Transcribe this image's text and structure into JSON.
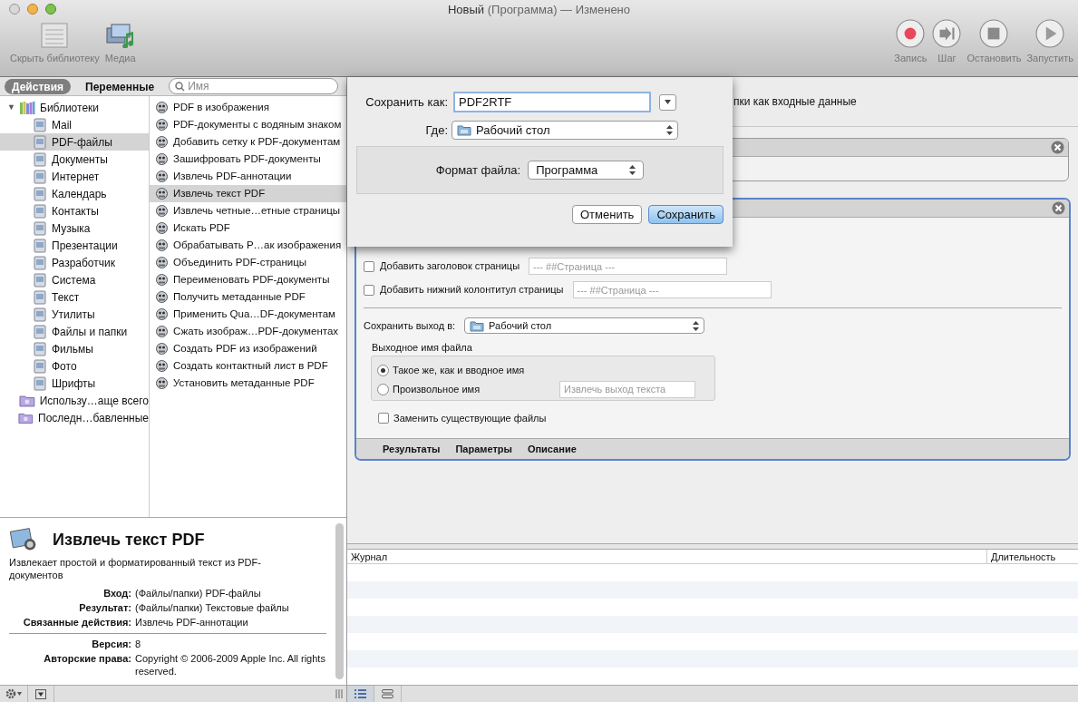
{
  "window": {
    "title_main": "Новый",
    "title_rest": "(Программа) — Изменено"
  },
  "toolbar_left": [
    {
      "label": "Скрыть библиотеку",
      "kind": "library"
    },
    {
      "label": "Медиа",
      "kind": "media"
    }
  ],
  "toolbar_right": [
    {
      "label": "Запись",
      "kind": "record"
    },
    {
      "label": "Шаг",
      "kind": "step"
    },
    {
      "label": "Остановить",
      "kind": "stop"
    },
    {
      "label": "Запустить",
      "kind": "run"
    }
  ],
  "tabs": [
    {
      "label": "Действия",
      "selected": true
    },
    {
      "label": "Переменные",
      "selected": false
    }
  ],
  "search": {
    "placeholder": "Имя"
  },
  "library": [
    {
      "label": "Библиотеки",
      "toggle": "▼",
      "expanded": true,
      "selected": false,
      "children": [
        {
          "label": "Mail",
          "selected": false
        },
        {
          "label": "PDF-файлы",
          "selected": true
        },
        {
          "label": "Документы",
          "selected": false
        },
        {
          "label": "Интернет",
          "selected": false
        },
        {
          "label": "Календарь",
          "selected": false
        },
        {
          "label": "Контакты",
          "selected": false
        },
        {
          "label": "Музыка",
          "selected": false
        },
        {
          "label": "Презентации",
          "selected": false
        },
        {
          "label": "Разработчик",
          "selected": false
        },
        {
          "label": "Система",
          "selected": false
        },
        {
          "label": "Текст",
          "selected": false
        },
        {
          "label": "Утилиты",
          "selected": false
        },
        {
          "label": "Файлы и папки",
          "selected": false
        },
        {
          "label": "Фильмы",
          "selected": false
        },
        {
          "label": "Фото",
          "selected": false
        },
        {
          "label": "Шрифты",
          "selected": false
        }
      ]
    },
    {
      "label": "Использу…аще всего",
      "selected": false
    },
    {
      "label": "Последн…бавленные",
      "selected": false
    }
  ],
  "actions": [
    {
      "label": "PDF в изображения",
      "selected": false
    },
    {
      "label": "PDF-документы с водяным знаком",
      "selected": false
    },
    {
      "label": "Добавить сетку к PDF-документам",
      "selected": false
    },
    {
      "label": "Зашифровать PDF-документы",
      "selected": false
    },
    {
      "label": "Извлечь PDF-аннотации",
      "selected": false
    },
    {
      "label": "Извлечь текст PDF",
      "selected": true
    },
    {
      "label": "Извлечь четные…етные страницы",
      "selected": false
    },
    {
      "label": "Искать PDF",
      "selected": false
    },
    {
      "label": "Обрабатывать P…ак изображения",
      "selected": false
    },
    {
      "label": "Объединить PDF-страницы",
      "selected": false
    },
    {
      "label": "Переименовать PDF-документы",
      "selected": false
    },
    {
      "label": "Получить метаданные PDF",
      "selected": false
    },
    {
      "label": "Применить Qua…DF-документам",
      "selected": false
    },
    {
      "label": "Сжать изображ…PDF-документах",
      "selected": false
    },
    {
      "label": "Создать PDF из изображений",
      "selected": false
    },
    {
      "label": "Создать контактный лист в PDF",
      "selected": false
    },
    {
      "label": "Установить метаданные PDF",
      "selected": false
    }
  ],
  "description": {
    "title": "Извлечь текст PDF",
    "text": "Извлекает простой и форматированный текст из PDF-документов",
    "fields": [
      {
        "label": "Вход:",
        "value": "(Файлы/папки) PDF-файлы"
      },
      {
        "label": "Результат:",
        "value": "(Файлы/папки) Текстовые файлы"
      },
      {
        "label": "Связанные действия:",
        "value": "Извлечь PDF-аннотации"
      }
    ],
    "meta": [
      {
        "label": "Версия:",
        "value": "8"
      },
      {
        "label": "Авторские права:",
        "value": "Copyright © 2006-2009 Apple Inc. All rights reserved."
      }
    ]
  },
  "workflow": {
    "banner": "пки как входные данные",
    "action": {
      "options": [
        {
          "label": "Добавить заголовок страницы",
          "checked": false,
          "placeholder": "--- ##Страница ---"
        },
        {
          "label": "Добавить нижний колонтитул страницы",
          "checked": false,
          "placeholder": "--- ##Страница ---"
        }
      ],
      "save_to_label": "Сохранить выход в:",
      "save_to_value": "Рабочий стол",
      "name_group_label": "Выходное имя файла",
      "name_options": [
        {
          "label": "Такое же, как и вводное имя",
          "selected": true
        },
        {
          "label": "Произвольное имя",
          "selected": false,
          "placeholder": "Извлечь выход текста"
        }
      ],
      "replace": {
        "label": "Заменить существующие файлы",
        "checked": false
      },
      "footer_tabs": [
        "Результаты",
        "Параметры",
        "Описание"
      ]
    }
  },
  "log": {
    "columns": [
      "Журнал",
      "Длительность"
    ]
  },
  "sheet": {
    "save_as_label": "Сохранить как:",
    "save_as_value": "PDF2RTF",
    "where_label": "Где:",
    "where_value": "Рабочий стол",
    "format_label": "Формат файла:",
    "format_value": "Программа",
    "buttons": [
      {
        "label": "Отменить",
        "kind": "cancel"
      },
      {
        "label": "Сохранить",
        "kind": "default"
      }
    ]
  }
}
